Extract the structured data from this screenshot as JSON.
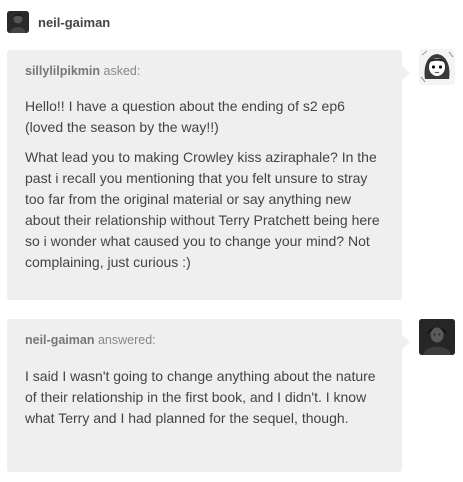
{
  "post": {
    "blog_name": "neil-gaiman",
    "ask": {
      "asker": "sillylilpikmin",
      "verb": "asked:",
      "paragraphs": [
        "Hello!! I have a question about the ending of s2 ep6 (loved the season by the way!!)",
        "What lead you to making Crowley kiss aziraphale? In the past i recall you mentioning that you felt unsure to stray too far from the original material or say anything new about their relationship without Terry Pratchett being here so i wonder what caused you to change your mind? Not complaining, just curious :)"
      ]
    },
    "answer": {
      "answerer": "neil-gaiman",
      "verb": "answered:",
      "paragraphs": [
        "I said I wasn't going to change anything about the nature of  their relationship in the first book, and I didn't. I know what Terry and I had planned for the sequel, though."
      ]
    },
    "icons": {
      "header_avatar": "blog-avatar-icon",
      "asker_avatar": "asker-avatar-icon",
      "answerer_avatar": "answerer-avatar-icon"
    },
    "colors": {
      "bubble_background": "#efefef",
      "text": "#444444",
      "byline": "#888888"
    }
  }
}
